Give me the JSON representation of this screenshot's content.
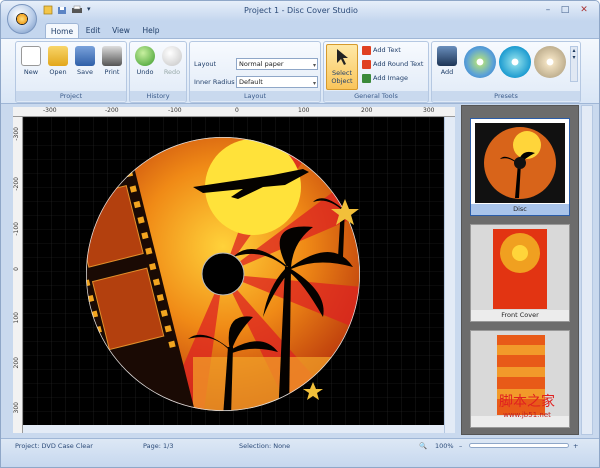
{
  "window": {
    "title": "Project 1 - Disc Cover Studio",
    "min": "–",
    "max": "□",
    "close": "✕"
  },
  "tabs": [
    "Home",
    "Edit",
    "View",
    "Help"
  ],
  "ribbon": {
    "project": {
      "label": "Project",
      "new": "New",
      "open": "Open",
      "save": "Save",
      "print": "Print"
    },
    "history": {
      "label": "History",
      "undo": "Undo",
      "redo": "Redo"
    },
    "layout": {
      "label": "Layout",
      "layout_label": "Layout",
      "layout_value": "Normal paper",
      "radius_label": "Inner Radius",
      "radius_value": "Default"
    },
    "tools": {
      "label": "General Tools",
      "select": "Select Object",
      "add_text": "Add Text",
      "add_round_text": "Add Round Text",
      "add_image": "Add Image"
    },
    "presets": {
      "label": "Presets",
      "add": "Add"
    }
  },
  "ruler": {
    "top": [
      "-300",
      "-200",
      "-100",
      "0",
      "100",
      "200",
      "300"
    ],
    "left": [
      "-300",
      "-200",
      "-100",
      "0",
      "100",
      "200",
      "300"
    ]
  },
  "presets_panel": [
    {
      "label": "Disc",
      "selected": true
    },
    {
      "label": "Front Cover",
      "selected": false
    },
    {
      "label": "",
      "selected": false
    }
  ],
  "status": {
    "project": "Project: DVD Case Clear",
    "page": "Page: 1/3",
    "selection": "Selection: None",
    "zoom": "100%"
  },
  "watermark": {
    "cn": "脚本之家",
    "url": "www.jb51.net"
  },
  "colors": {
    "accent": "#2c5da8",
    "canvas": "#000000",
    "ribbon": "#d9e6f6"
  }
}
